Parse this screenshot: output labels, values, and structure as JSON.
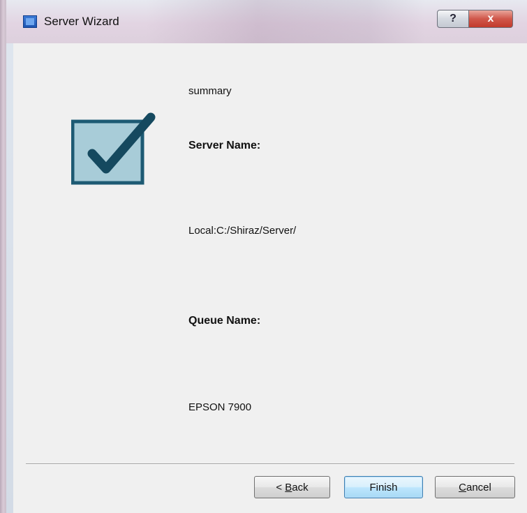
{
  "window": {
    "title": "Server Wizard",
    "help_button_label": "?",
    "close_button_label": "x"
  },
  "summary": {
    "heading": "summary",
    "server_name_label": "Server Name:",
    "server_name_value": "Local:C:/Shiraz/Server/",
    "queue_name_label": "Queue Name:",
    "queue_name_value": "EPSON 7900"
  },
  "buttons": {
    "back": {
      "prefix": "< ",
      "mnemonic": "B",
      "rest": "ack"
    },
    "finish": "Finish",
    "cancel": {
      "mnemonic": "C",
      "rest": "ancel"
    }
  },
  "colors": {
    "check_box_fill": "#a8ccd8",
    "check_box_border": "#1d5a73",
    "check_mark": "#15495f",
    "client_background": "#f0f0f0",
    "close_button": "#c9483a"
  }
}
